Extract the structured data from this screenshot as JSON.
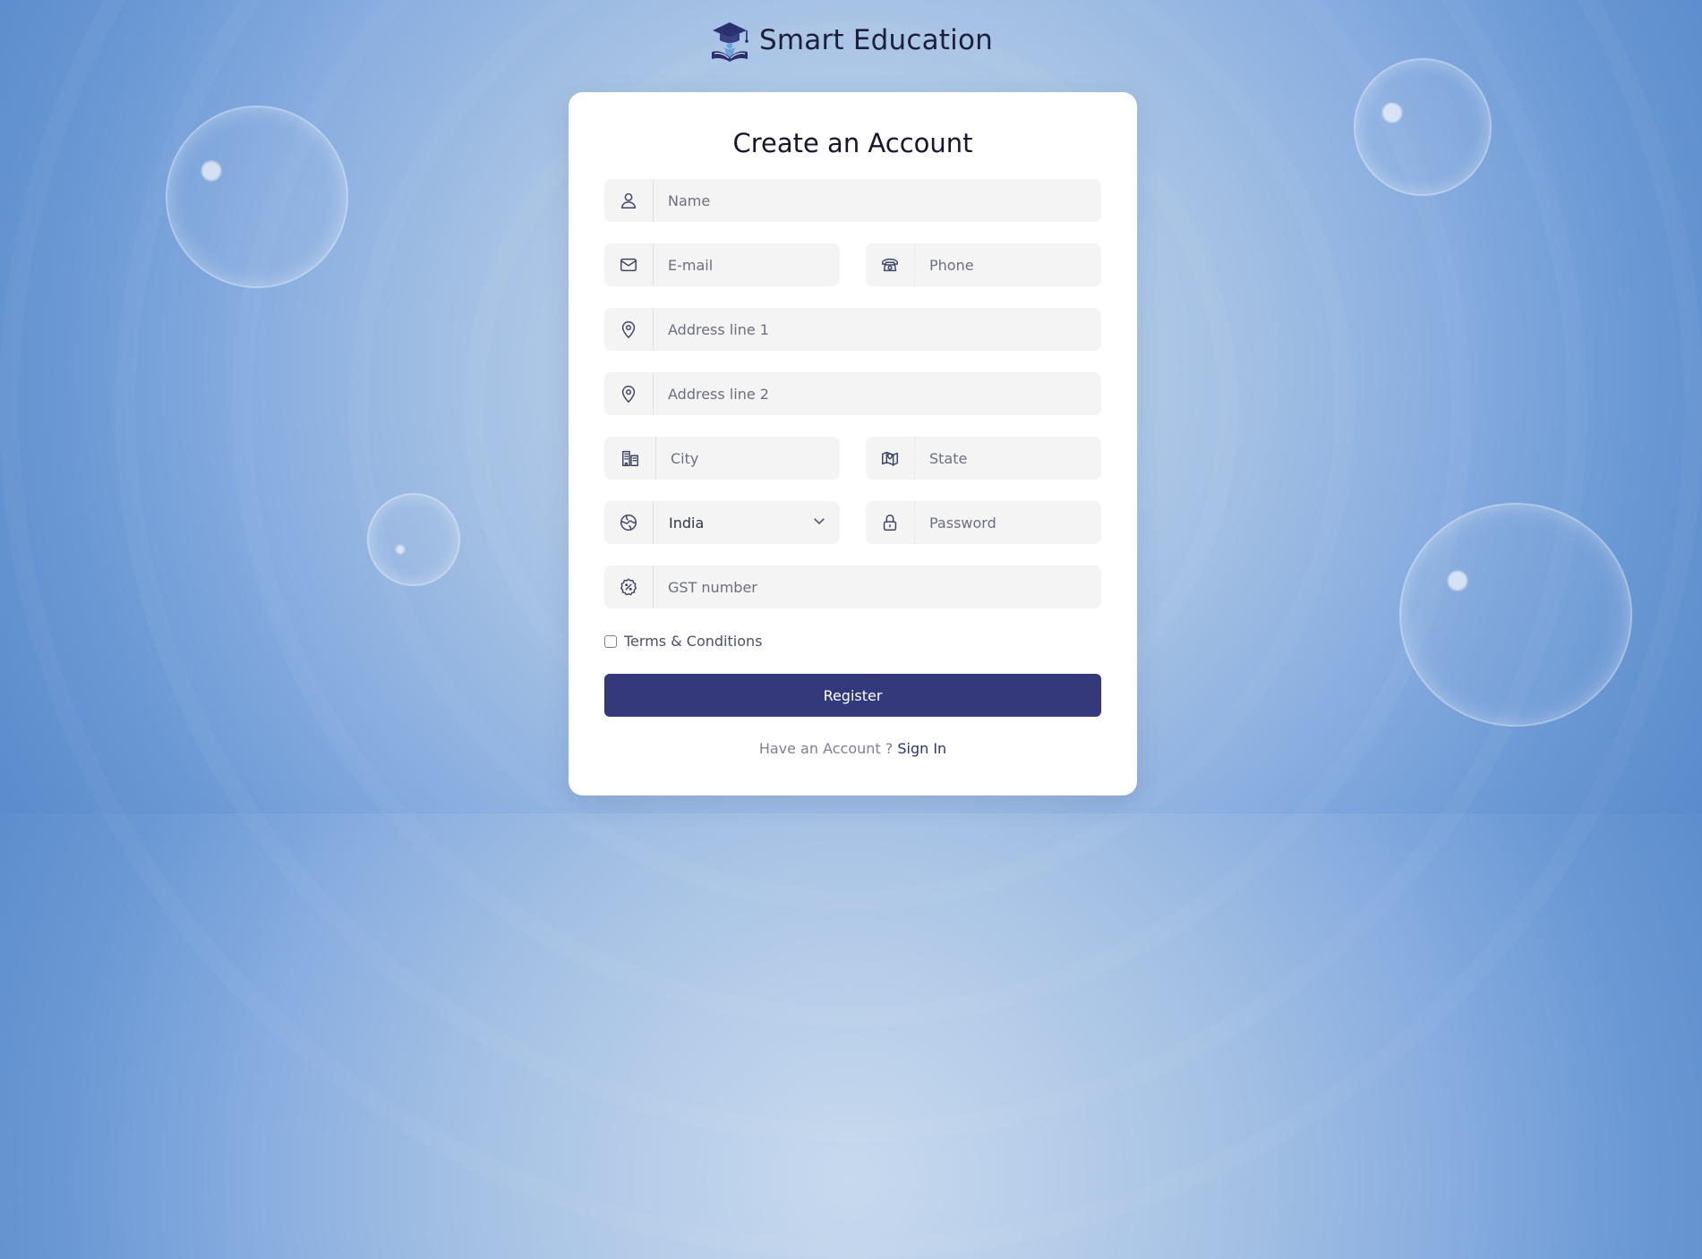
{
  "brand": {
    "title": "Smart Education",
    "logo_icon": "graduation-cap-book-icon"
  },
  "form": {
    "title": "Create an Account",
    "name": {
      "placeholder": "Name",
      "icon": "user-icon"
    },
    "email": {
      "placeholder": "E-mail",
      "icon": "envelope-icon"
    },
    "phone": {
      "placeholder": "Phone",
      "icon": "telephone-icon"
    },
    "address1": {
      "placeholder": "Address line 1",
      "icon": "map-pin-icon"
    },
    "address2": {
      "placeholder": "Address line 2",
      "icon": "map-pin-icon"
    },
    "city": {
      "placeholder": "City",
      "icon": "buildings-icon"
    },
    "state": {
      "placeholder": "State",
      "icon": "map-icon"
    },
    "country": {
      "selected": "India",
      "icon": "globe-icon"
    },
    "password": {
      "placeholder": "Password",
      "icon": "lock-icon"
    },
    "gst": {
      "placeholder": "GST number",
      "icon": "percent-badge-icon"
    },
    "terms_label": "Terms & Conditions",
    "register_label": "Register",
    "signin_prompt": "Have an Account ? ",
    "signin_link": "Sign In"
  },
  "colors": {
    "primary_button": "#33397a",
    "field_background": "#f4f4f4",
    "background": "#a2bfe3"
  }
}
